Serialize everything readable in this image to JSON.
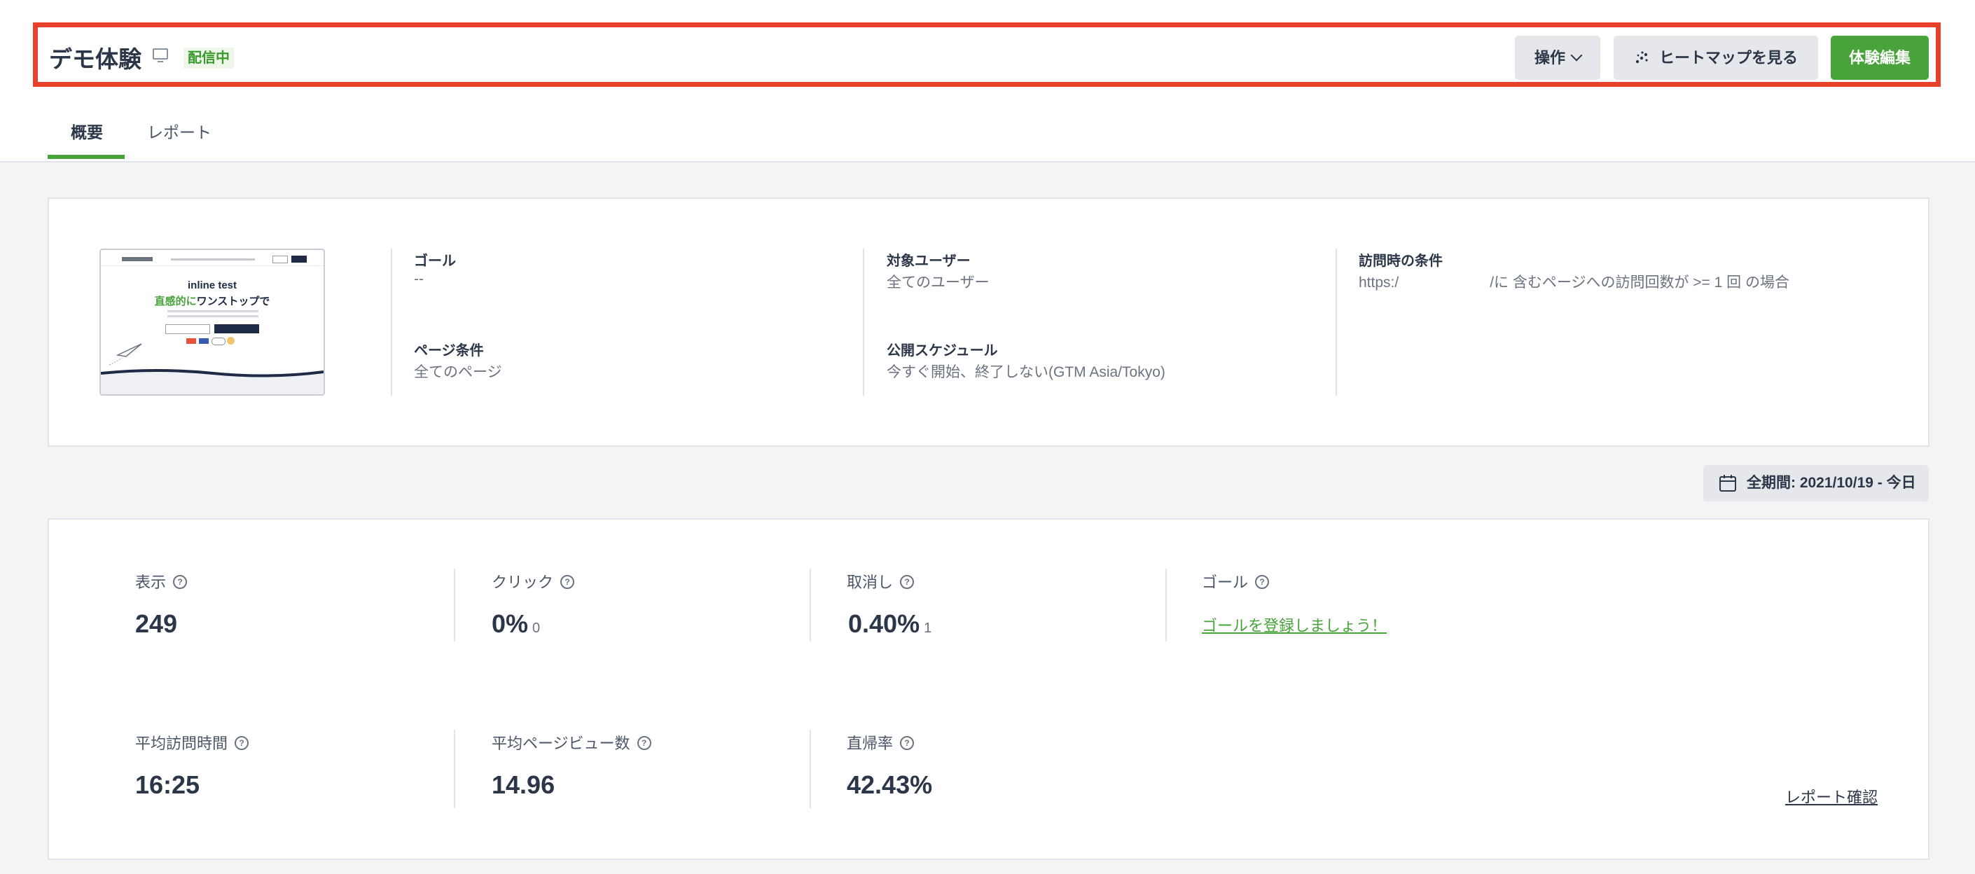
{
  "header": {
    "title": "デモ体験",
    "status_badge": "配信中",
    "operations_label": "操作",
    "heatmap_label": "ヒートマップを見る",
    "edit_label": "体験編集"
  },
  "tabs": [
    {
      "label": "概要",
      "active": true
    },
    {
      "label": "レポート",
      "active": false
    }
  ],
  "info": {
    "thumbnail": {
      "headline": "inline test",
      "subline_green": "直感的に",
      "subline_dark": "ワンストップで"
    },
    "goal_label": "ゴール",
    "goal_value": "--",
    "page_condition_label": "ページ条件",
    "page_condition_value": "全てのページ",
    "target_users_label": "対象ユーザー",
    "target_users_value": "全てのユーザー",
    "schedule_label": "公開スケジュール",
    "schedule_value": "今すぐ開始、終了しない(GTM Asia/Tokyo)",
    "visit_condition_label": "訪問時の条件",
    "visit_condition_prefix": "https:/",
    "visit_condition_suffix": "/に 含むページへの訪問回数が >= 1 回 の場合"
  },
  "date_range": "全期間: 2021/10/19 - 今日",
  "stats": {
    "impressions_label": "表示",
    "impressions_value": "249",
    "clicks_label": "クリック",
    "clicks_value": "0%",
    "clicks_count": "0",
    "cancel_label": "取消し",
    "cancel_value": "0.40%",
    "cancel_count": "1",
    "goal_label": "ゴール",
    "goal_link": "ゴールを登録しましょう！",
    "avg_visit_time_label": "平均訪問時間",
    "avg_visit_time_value": "16:25",
    "avg_pageviews_label": "平均ページビュー数",
    "avg_pageviews_value": "14.96",
    "bounce_label": "直帰率",
    "bounce_value": "42.43%",
    "report_link": "レポート確認"
  },
  "colors": {
    "accent_green": "#47a33a",
    "highlight_red": "#e8402a",
    "text_dark": "#2b3648"
  },
  "icons": [
    "desktop-icon",
    "chevron-down-icon",
    "heatmap-icon",
    "calendar-icon",
    "help-icon"
  ]
}
